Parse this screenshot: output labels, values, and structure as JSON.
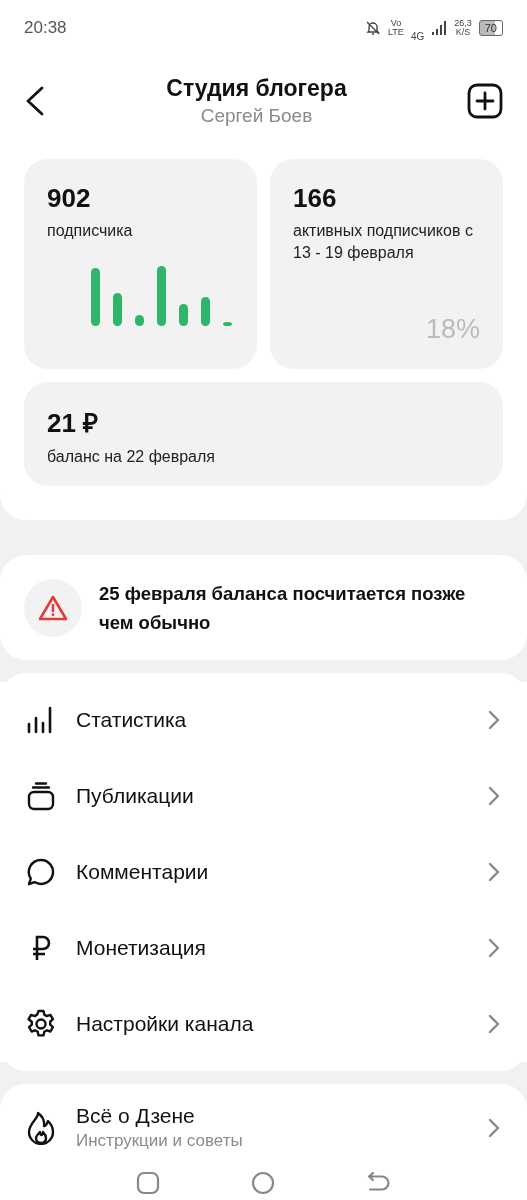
{
  "status_bar": {
    "time": "20:38",
    "network_top": "Vo",
    "network_bottom": "LTE",
    "signal_label": "4G",
    "speed_value": "26,3",
    "speed_unit": "K/S",
    "battery": "70"
  },
  "header": {
    "title": "Студия блогера",
    "subtitle": "Сергей Боев"
  },
  "stats": [
    {
      "value": "902",
      "label": "подписчика",
      "kind": "chart"
    },
    {
      "value": "166",
      "label": "активных подписчиков с 13 - 19 февраля",
      "percent": "18%",
      "kind": "percent"
    }
  ],
  "balance": {
    "value": "21 ₽",
    "label": "баланс на 22 февраля"
  },
  "alert": {
    "text": "25 февраля баланса посчитается позже чем обычно"
  },
  "menu": [
    {
      "kind": "stats",
      "label": "Статистика"
    },
    {
      "kind": "posts",
      "label": "Публикации"
    },
    {
      "kind": "comments",
      "label": "Комментарии"
    },
    {
      "kind": "money",
      "label": "Монетизация"
    },
    {
      "kind": "settings",
      "label": "Настройки канала"
    }
  ],
  "help": {
    "kind": "fire",
    "label": "Всё о Дзене",
    "subtitle": "Инструкции и советы"
  }
}
